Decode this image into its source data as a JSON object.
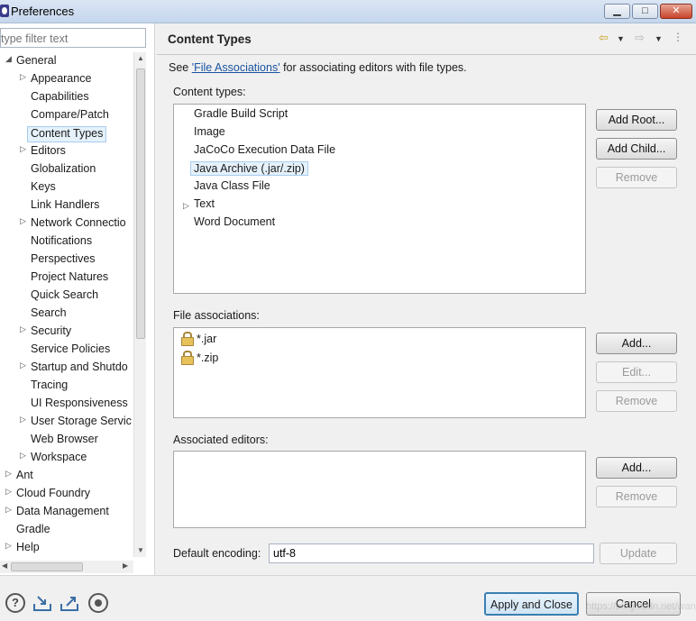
{
  "window": {
    "title": "Preferences"
  },
  "filter": {
    "placeholder": "type filter text"
  },
  "tree": [
    {
      "label": "General",
      "level": 0,
      "expanded": true
    },
    {
      "label": "Appearance",
      "level": 1,
      "expandable": true
    },
    {
      "label": "Capabilities",
      "level": 1
    },
    {
      "label": "Compare/Patch",
      "level": 1
    },
    {
      "label": "Content Types",
      "level": 1,
      "selected": true
    },
    {
      "label": "Editors",
      "level": 1,
      "expandable": true
    },
    {
      "label": "Globalization",
      "level": 1
    },
    {
      "label": "Keys",
      "level": 1
    },
    {
      "label": "Link Handlers",
      "level": 1
    },
    {
      "label": "Network Connectio",
      "level": 1,
      "expandable": true
    },
    {
      "label": "Notifications",
      "level": 1
    },
    {
      "label": "Perspectives",
      "level": 1
    },
    {
      "label": "Project Natures",
      "level": 1
    },
    {
      "label": "Quick Search",
      "level": 1
    },
    {
      "label": "Search",
      "level": 1
    },
    {
      "label": "Security",
      "level": 1,
      "expandable": true
    },
    {
      "label": "Service Policies",
      "level": 1
    },
    {
      "label": "Startup and Shutdo",
      "level": 1,
      "expandable": true
    },
    {
      "label": "Tracing",
      "level": 1
    },
    {
      "label": "UI Responsiveness",
      "level": 1
    },
    {
      "label": "User Storage Servic",
      "level": 1,
      "expandable": true
    },
    {
      "label": "Web Browser",
      "level": 1
    },
    {
      "label": "Workspace",
      "level": 1,
      "expandable": true
    },
    {
      "label": "Ant",
      "level": 0,
      "expandable": true
    },
    {
      "label": "Cloud Foundry",
      "level": 0,
      "expandable": true
    },
    {
      "label": "Data Management",
      "level": 0,
      "expandable": true
    },
    {
      "label": "Gradle",
      "level": 0
    },
    {
      "label": "Help",
      "level": 0,
      "expandable": true
    }
  ],
  "page": {
    "title": "Content Types",
    "desc_prefix": "See ",
    "desc_link": "'File Associations'",
    "desc_suffix": " for associating editors with file types."
  },
  "content_types": {
    "label": "Content types:",
    "items": [
      {
        "label": "Gradle Build Script"
      },
      {
        "label": "Image"
      },
      {
        "label": "JaCoCo Execution Data File"
      },
      {
        "label": "Java Archive (.jar/.zip)",
        "selected": true
      },
      {
        "label": "Java Class File"
      },
      {
        "label": "Text",
        "expandable": true
      },
      {
        "label": "Word Document"
      }
    ],
    "buttons": {
      "add_root": "Add Root...",
      "add_child": "Add Child...",
      "remove": "Remove"
    }
  },
  "file_associations": {
    "label": "File associations:",
    "items": [
      {
        "label": "*.jar"
      },
      {
        "label": "*.zip"
      }
    ],
    "buttons": {
      "add": "Add...",
      "edit": "Edit...",
      "remove": "Remove"
    }
  },
  "associated_editors": {
    "label": "Associated editors:",
    "buttons": {
      "add": "Add...",
      "remove": "Remove"
    }
  },
  "encoding": {
    "label": "Default encoding:",
    "value": "utf-8",
    "update": "Update"
  },
  "footer": {
    "apply_close": "Apply and Close",
    "cancel": "Cancel",
    "watermark": "https://blog.csdn.net/wangyi"
  },
  "icons": [
    "help-icon",
    "import-icon",
    "export-icon",
    "oomph-icon",
    "lock-icon",
    "back-arrow-icon",
    "forward-arrow-icon",
    "view-menu-icon"
  ]
}
